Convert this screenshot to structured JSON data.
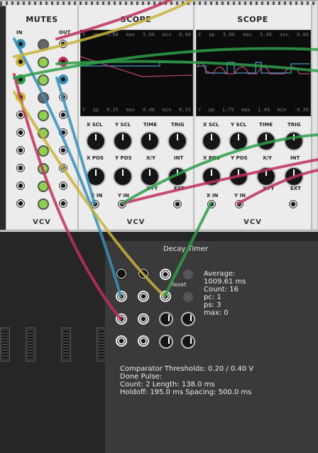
{
  "mutes": {
    "title": "MUTES",
    "in_label": "IN",
    "out_label": "OUT",
    "brand": "VCV"
  },
  "scope1": {
    "title": "SCOPE",
    "stats_top": [
      "X",
      "pp",
      "5.00",
      "max",
      "5.00",
      "min",
      "0.00"
    ],
    "stats_bottom": [
      "Y",
      "pp",
      "0.25",
      "max",
      "0.40",
      "min",
      "0.15"
    ],
    "labels": {
      "x_scl": "X SCL",
      "y_scl": "Y SCL",
      "time": "TIME",
      "trig": "TRIG",
      "x_pos": "X POS",
      "y_pos": "Y POS",
      "xy": "X/Y",
      "int": "INT",
      "x_plus_y": "X+Y",
      "ext": "EXT",
      "x_in": "X IN",
      "y_in": "Y IN"
    },
    "brand": "VCV"
  },
  "scope2": {
    "title": "SCOPE",
    "stats_top": [
      "X",
      "pp",
      "5.00",
      "max",
      "5.00",
      "min",
      "0.00"
    ],
    "stats_bottom": [
      "Y",
      "pp",
      "1.75",
      "max",
      "1.49",
      "min",
      "-0.26"
    ],
    "labels": {
      "x_scl": "X SCL",
      "y_scl": "Y SCL",
      "time": "TIME",
      "trig": "TRIG",
      "x_pos": "X POS",
      "y_pos": "Y POS",
      "xy": "X/Y",
      "int": "INT",
      "x_plus_y": "X+Y",
      "ext": "EXT",
      "x_in": "X IN",
      "y_in": "Y IN"
    },
    "brand": "VCV"
  },
  "decay_timer": {
    "title": "Decay Timer",
    "reset_label": "Reset",
    "stats": [
      "Average:",
      "1009.61 ms",
      "Count: 16",
      "pc: 1",
      "ps: 3",
      "max: 0"
    ]
  },
  "comparator": {
    "lines": [
      "Comparator Thresholds: 0.20 / 0.40 V",
      "Done Pulse:",
      "Count: 2 Length: 138.0 ms",
      "Holdoff: 195.0 ms Spacing: 500.0 ms"
    ]
  },
  "colors": {
    "cable_blue": "#3a8fb8",
    "cable_red": "#c0305a",
    "cable_green": "#2f9e4a",
    "cable_yellow": "#c8b43c",
    "led_green": "#8fd14f",
    "trace_cyan": "#4ab8e8",
    "trace_pink": "#e0508a"
  }
}
